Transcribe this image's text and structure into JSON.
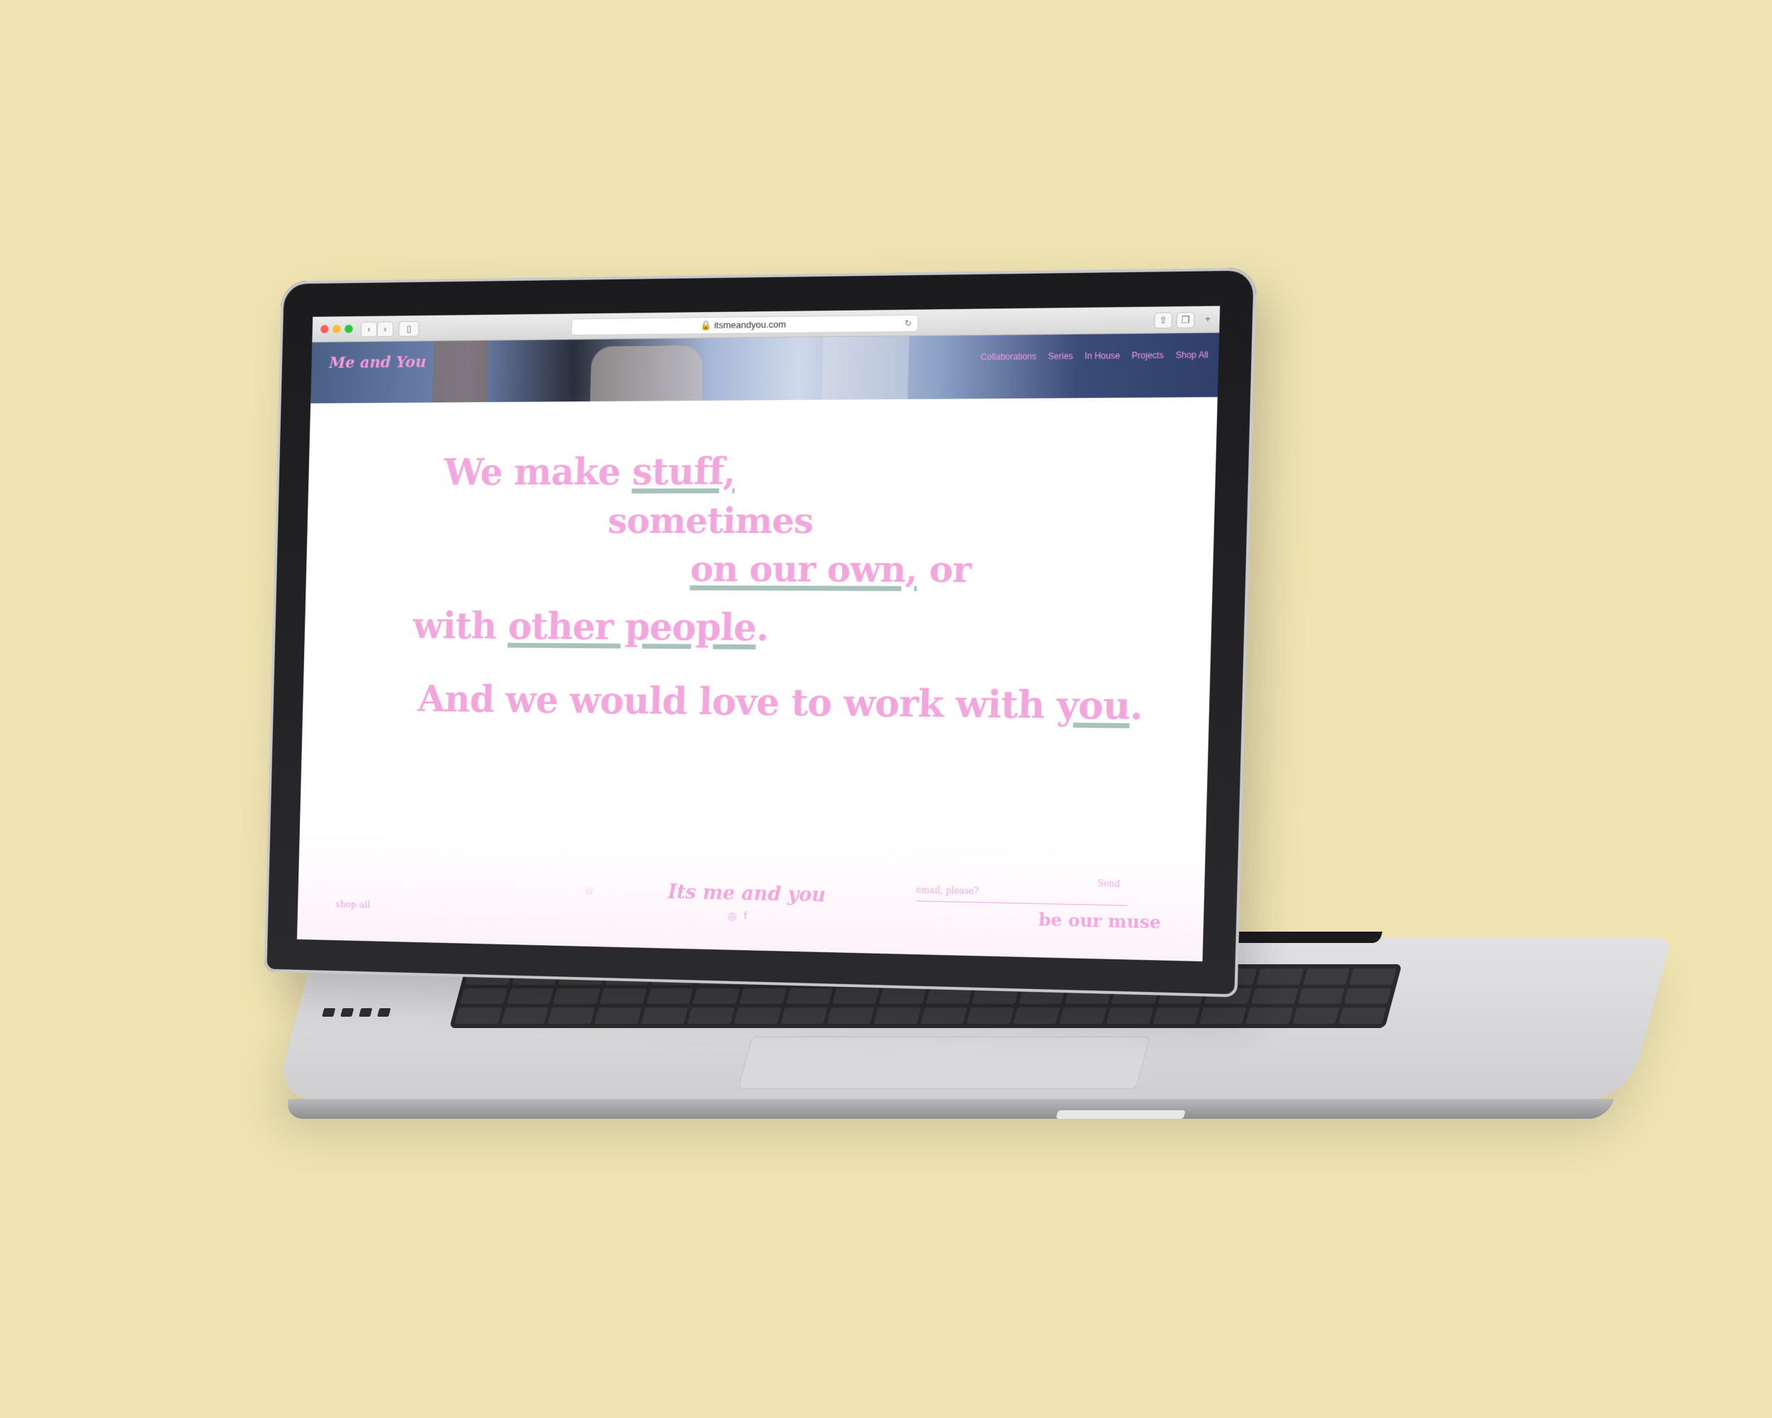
{
  "browser": {
    "url": "itsmeandyou.com"
  },
  "site": {
    "logo": "Me and You",
    "nav": [
      "Collaborations",
      "Series",
      "In House",
      "Projects",
      "Shop All"
    ]
  },
  "hero_text": {
    "line1_a": "We make ",
    "line1_u": "stuff,",
    "line2": "sometimes",
    "line3_u": "on our own,",
    "line3_b": " or",
    "line4_a": "with ",
    "line4_u": "other people",
    "line4_b": ".",
    "line5_a": "And we would love to work with ",
    "line5_u": "you",
    "line5_b": "."
  },
  "footer": {
    "shop_all": "shop all",
    "brand": "Its me and you",
    "email_placeholder": "email, please?",
    "send": "Send",
    "muse": "be our muse"
  },
  "colors": {
    "background": "#efe3b2",
    "pink_text": "#f2a6dc",
    "underline": "#a9c1bb"
  }
}
